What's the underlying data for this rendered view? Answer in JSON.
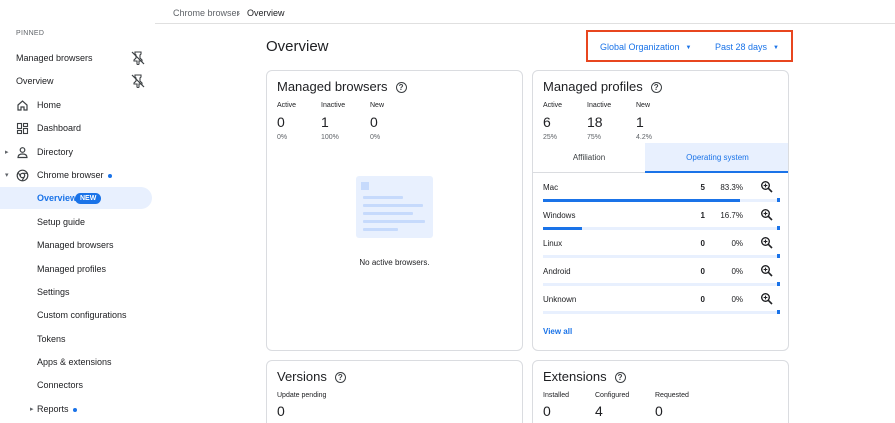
{
  "sidebar": {
    "pinned_label": "PINNED",
    "pinned": [
      {
        "label": "Managed browsers"
      },
      {
        "label": "Overview"
      }
    ],
    "nav": [
      {
        "label": "Home"
      },
      {
        "label": "Dashboard"
      },
      {
        "label": "Directory"
      },
      {
        "label": "Chrome browser"
      },
      {
        "label": "Overview",
        "badge": "NEW"
      },
      {
        "label": "Setup guide"
      },
      {
        "label": "Managed browsers"
      },
      {
        "label": "Managed profiles"
      },
      {
        "label": "Settings"
      },
      {
        "label": "Custom configurations"
      },
      {
        "label": "Tokens"
      },
      {
        "label": "Apps & extensions"
      },
      {
        "label": "Connectors"
      },
      {
        "label": "Reports"
      }
    ]
  },
  "breadcrumb": {
    "parent": "Chrome browser",
    "separator": "›",
    "current": "Overview"
  },
  "header": {
    "title": "Overview",
    "org_filter": "Global Organization",
    "period_filter": "Past 28 days"
  },
  "managed_browsers": {
    "title": "Managed browsers",
    "help": "?",
    "stats": [
      {
        "label": "Active",
        "value": "0",
        "pct": "0%"
      },
      {
        "label": "Inactive",
        "value": "1",
        "pct": "100%"
      },
      {
        "label": "New",
        "value": "0",
        "pct": "0%"
      }
    ],
    "empty_text": "No active browsers."
  },
  "managed_profiles": {
    "title": "Managed profiles",
    "help": "?",
    "stats": [
      {
        "label": "Active",
        "value": "6",
        "pct": "25%"
      },
      {
        "label": "Inactive",
        "value": "18",
        "pct": "75%"
      },
      {
        "label": "New",
        "value": "1",
        "pct": "4.2%"
      }
    ],
    "tabs": [
      {
        "label": "Affiliation"
      },
      {
        "label": "Operating system"
      }
    ],
    "rows": [
      {
        "name": "Mac",
        "count": "5",
        "pct": "83.3%",
        "fraction": 0.833
      },
      {
        "name": "Windows",
        "count": "1",
        "pct": "16.7%",
        "fraction": 0.167
      },
      {
        "name": "Linux",
        "count": "0",
        "pct": "0%",
        "fraction": 0
      },
      {
        "name": "Android",
        "count": "0",
        "pct": "0%",
        "fraction": 0
      },
      {
        "name": "Unknown",
        "count": "0",
        "pct": "0%",
        "fraction": 0
      }
    ],
    "view_all": "View all"
  },
  "versions": {
    "title": "Versions",
    "help": "?",
    "stats": [
      {
        "label": "Update pending",
        "value": "0"
      }
    ]
  },
  "extensions": {
    "title": "Extensions",
    "help": "?",
    "stats": [
      {
        "label": "Installed",
        "value": "0"
      },
      {
        "label": "Configured",
        "value": "4"
      },
      {
        "label": "Requested",
        "value": "0"
      }
    ]
  },
  "colors": {
    "accent": "#1a73e8",
    "highlight_border": "#e8461f",
    "active_bg": "#e8f0fe"
  },
  "icons": {
    "unpin": "unpin-icon",
    "home": "home-icon",
    "dashboard": "dashboard-icon",
    "directory": "person-icon",
    "chrome": "chrome-icon",
    "zoom": "zoom-in-icon",
    "help": "help-circle-icon"
  }
}
